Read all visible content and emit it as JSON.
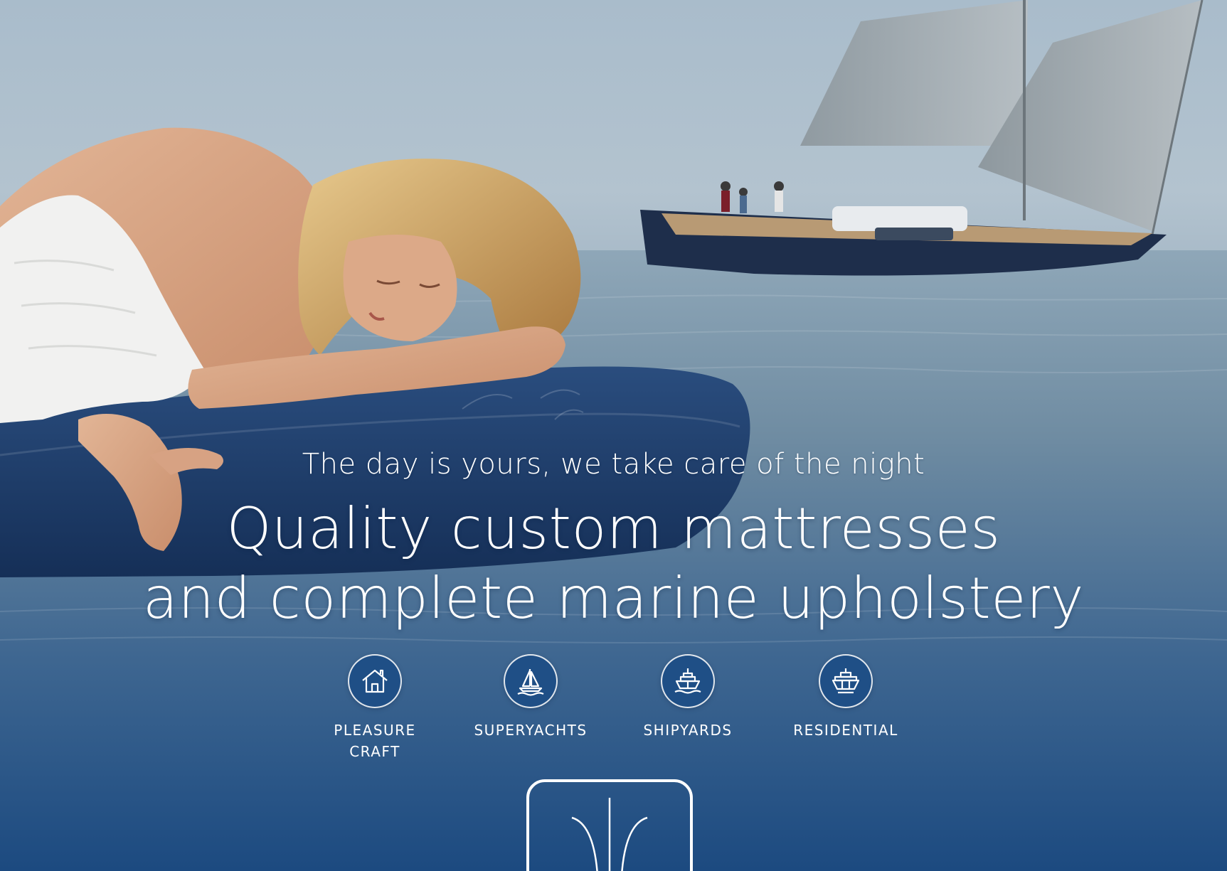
{
  "hero": {
    "tagline": "The day is yours, we take care of the night",
    "headline_line1": "Quality custom mattresses",
    "headline_line2": "and complete marine upholstery"
  },
  "categories": [
    {
      "label": "PLEASURE\nCRAFT",
      "icon": "house-icon"
    },
    {
      "label": "SUPERYACHTS",
      "icon": "sailboat-icon"
    },
    {
      "label": "SHIPYARDS",
      "icon": "ship-icon"
    },
    {
      "label": "RESIDENTIAL",
      "icon": "cruise-ship-icon"
    }
  ],
  "colors": {
    "icon_background": "#1f4f86",
    "mattress": "#1d3c6b",
    "sea_deep": "#1c4a80"
  }
}
